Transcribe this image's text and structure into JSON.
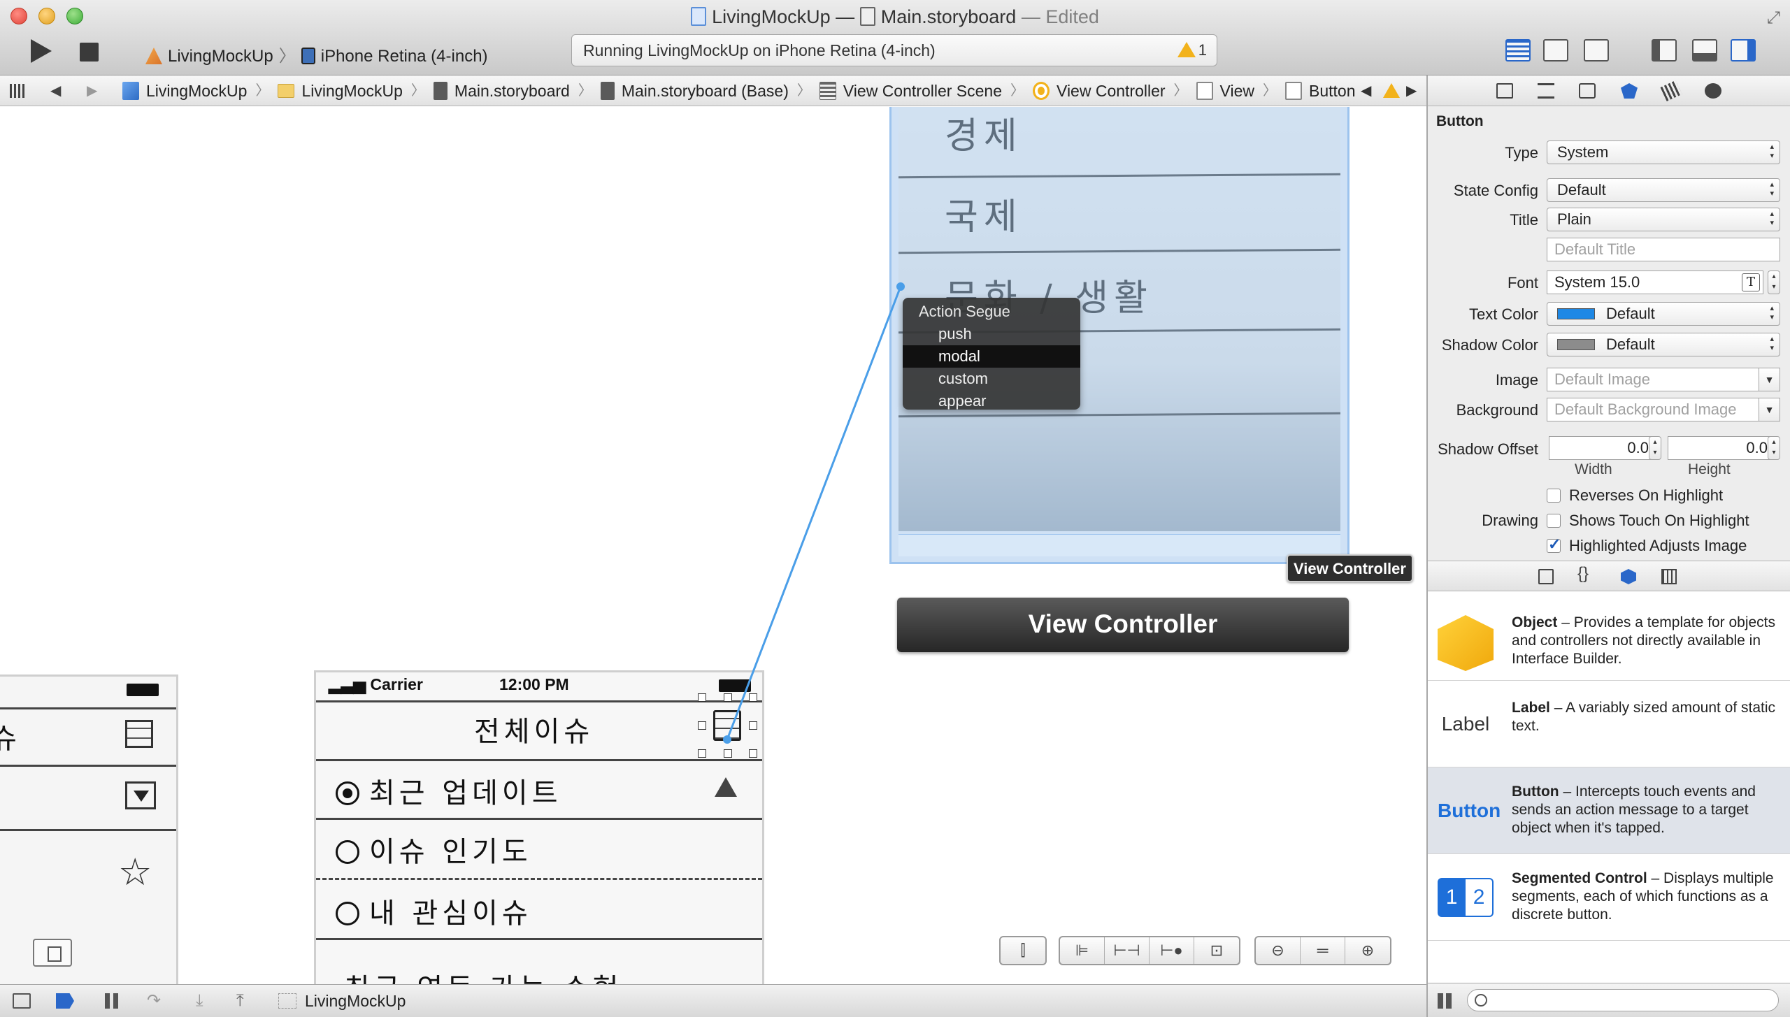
{
  "window": {
    "title_project": "LivingMockUp —",
    "title_file": "Main.storyboard",
    "title_status": "— Edited"
  },
  "toolbar": {
    "scheme": "LivingMockUp",
    "destination": "iPhone Retina (4-inch)",
    "activity": "Running LivingMockUp on iPhone Retina (4-inch)",
    "warning_count": "1"
  },
  "jumpbar": {
    "crumbs": [
      "LivingMockUp",
      "LivingMockUp",
      "Main.storyboard",
      "Main.storyboard (Base)",
      "View Controller Scene",
      "View Controller",
      "View",
      "Button"
    ]
  },
  "canvas": {
    "top_scene_rows": [
      "경제",
      "국제",
      "문화 / 생활"
    ],
    "segue_menu": {
      "header": "Action Segue",
      "items": [
        "push",
        "modal",
        "custom",
        "appear"
      ],
      "selected": "modal"
    },
    "tooltip": "View Controller",
    "dock_bar_title": "View Controller",
    "main_scene": {
      "carrier": "Carrier",
      "time": "12:00 PM",
      "nav_title": "전체이슈",
      "options": [
        "최근 업데이트",
        "이슈 인기도",
        "내 관심이슈",
        "최근 연동 가능 수험"
      ]
    },
    "left_scene_text": "슈"
  },
  "debugbar": {
    "target": "LivingMockUp"
  },
  "inspector": {
    "section": "Button",
    "type_label": "Type",
    "type_value": "System",
    "state_config_label": "State Config",
    "state_config_value": "Default",
    "title_label": "Title",
    "title_value": "Plain",
    "title_placeholder": "Default Title",
    "font_label": "Font",
    "font_value": "System 15.0",
    "text_color_label": "Text Color",
    "text_color_value": "Default",
    "text_color_hex": "#1e88e5",
    "shadow_color_label": "Shadow Color",
    "shadow_color_value": "Default",
    "shadow_color_hex": "#8c8c8c",
    "image_label": "Image",
    "image_placeholder": "Default Image",
    "background_label": "Background",
    "background_placeholder": "Default Background Image",
    "shadow_offset_label": "Shadow Offset",
    "shadow_width": "0.0",
    "shadow_height": "0.0",
    "width_caption": "Width",
    "height_caption": "Height",
    "drawing_label": "Drawing",
    "reverses_on_highlight": "Reverses On Highlight",
    "shows_touch": "Shows Touch On Highlight",
    "highlighted_adjusts": "Highlighted Adjusts Image"
  },
  "library": {
    "items": [
      {
        "name": "Object",
        "desc": " – Provides a template for objects and controllers not directly available in Interface Builder."
      },
      {
        "name": "Label",
        "desc": " – A variably sized amount of static text.",
        "icon_text": "Label"
      },
      {
        "name": "Button",
        "desc": " – Intercepts touch events and sends an action message to a target object when it's tapped.",
        "icon_text": "Button"
      },
      {
        "name": "Segmented Control",
        "desc": " – Displays multiple segments, each of which functions as a discrete button.",
        "icon_seg1": "1",
        "icon_seg2": "2"
      }
    ]
  },
  "colors": {
    "accent": "#2a67c9",
    "connection_line": "#4a9ee8",
    "selection_tint": "#cfe1f5"
  }
}
